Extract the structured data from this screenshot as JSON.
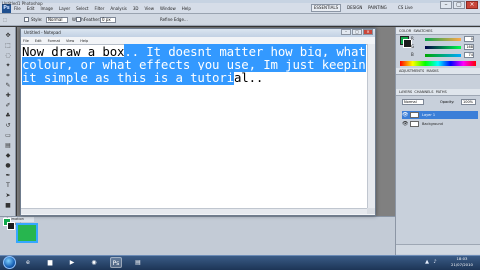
{
  "photoshop": {
    "title": "Untitled1 Photoshop",
    "logo": "Ps",
    "menu": [
      "File",
      "Edit",
      "Image",
      "Layer",
      "Select",
      "Filter",
      "Analysis",
      "3D",
      "View",
      "Window",
      "Help"
    ],
    "workspace_button": "ESSENTIALS",
    "design_link": "DESIGN",
    "painting_link": "PAINTING",
    "cs_live": "CS Live",
    "options": {
      "style_label": "Style:",
      "style_value": "Normal",
      "width_label": "Width:",
      "height_label": "Height:",
      "feather_label": "Feather:",
      "feather_value": "0 px",
      "refine_edge": "Refine Edge..."
    },
    "animation_tab": "Animation (Frames)"
  },
  "notepad": {
    "title": "Untitled - Notepad",
    "menu": [
      "File",
      "Edit",
      "Format",
      "View",
      "Help"
    ],
    "lines": [
      {
        "plain": "Now draw a box",
        "selected": ".. It doesnt matter how big, what"
      },
      {
        "plain": "",
        "selected": "colour, or what effects you use, Im just keepin"
      },
      {
        "plain_after": "al..",
        "selected": "it simple as this is a tutori"
      }
    ]
  },
  "panels": {
    "color_tab": "COLOR",
    "swatches_tab": "SWATCHES",
    "adjustments_tab": "ADJUSTMENTS",
    "masks_tab": "MASKS",
    "layers_tab": "LAYERS",
    "channels_tab": "CHANNELS",
    "paths_tab": "PATHS",
    "sliders": [
      {
        "label": "R",
        "value": "0"
      },
      {
        "label": "G",
        "value": "168"
      },
      {
        "label": "B",
        "value": "74"
      }
    ],
    "blend_mode": "Normal",
    "opacity_label": "Opacity:",
    "opacity_value": "100%",
    "layers": [
      {
        "name": "Layer 1",
        "active": true
      },
      {
        "name": "Background",
        "active": false
      }
    ]
  },
  "taskbar": {
    "time": "18:03",
    "date": "21/07/2010"
  },
  "colors": {
    "foreground": "#10a84a",
    "background": "#1c1c1c",
    "selection": "#3399ff"
  }
}
